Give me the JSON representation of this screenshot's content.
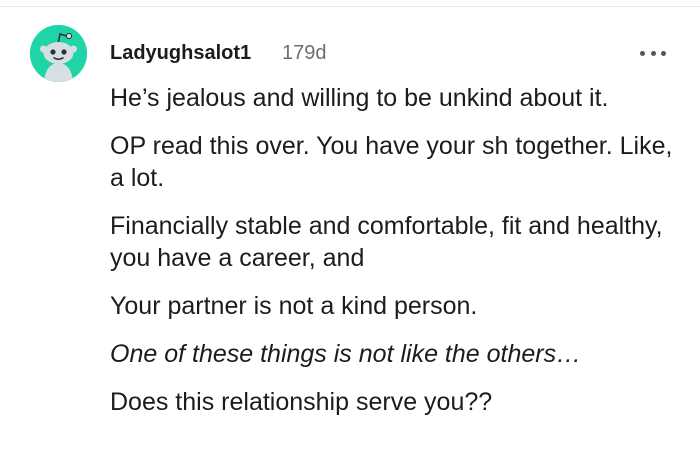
{
  "comment": {
    "username": "Ladyughsalot1",
    "age": "179d",
    "avatar_icon": "snoo-avatar-icon",
    "avatar_color": "#1fd5a8",
    "more_icon": "more-options-icon",
    "paragraphs": [
      "He’s jealous and willing to be unkind about it.",
      "OP read this over. You have your sh together. Like, a lot.",
      "Financially stable and comfortable, fit and healthy, you have a career, and",
      "Your partner is not a kind person.",
      "One of these things is not like the others…",
      "Does this relationship serve you??"
    ]
  }
}
